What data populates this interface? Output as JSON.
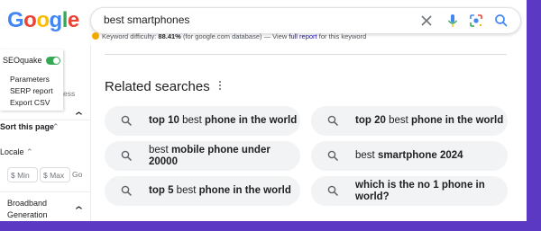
{
  "search": {
    "query": "best smartphones",
    "clear_icon": "close-icon",
    "voice_icon": "microphone-icon",
    "lens_icon": "lens-icon",
    "search_icon": "search-icon"
  },
  "logo": {
    "letters": [
      "G",
      "o",
      "o",
      "g",
      "l",
      "e"
    ],
    "colors": [
      "#4285f4",
      "#ea4335",
      "#fbbc05",
      "#4285f4",
      "#34a853",
      "#ea4335"
    ]
  },
  "keyword_difficulty": {
    "label": "Keyword difficulty:",
    "value": "88.41%",
    "note": "(for google.com database) — View",
    "link": "full report",
    "suffix": "for this keyword"
  },
  "seoquake": {
    "title": "SEOquake",
    "toggle_on": true,
    "items": [
      "Parameters",
      "SERP report",
      "Export CSV"
    ]
  },
  "left_panel": {
    "truncated_label": "ess",
    "sort_label": "Sort this page",
    "locale_label": "Locale",
    "price_min_placeholder": "$ Min",
    "price_max_placeholder": "$ Max",
    "go_label": "Go",
    "broadband_label": "Broadband Generation"
  },
  "related": {
    "title": "Related searches",
    "chips": [
      {
        "parts": [
          {
            "t": "top 10",
            "b": true
          },
          {
            "t": " best ",
            "b": false
          },
          {
            "t": "phone in the world",
            "b": true
          }
        ]
      },
      {
        "parts": [
          {
            "t": "top 20",
            "b": true
          },
          {
            "t": " best ",
            "b": false
          },
          {
            "t": "phone in the world",
            "b": true
          }
        ]
      },
      {
        "parts": [
          {
            "t": "best ",
            "b": false
          },
          {
            "t": "mobile phone under 20000",
            "b": true
          }
        ]
      },
      {
        "parts": [
          {
            "t": "best ",
            "b": false
          },
          {
            "t": "smartphone 2024",
            "b": true
          }
        ]
      },
      {
        "parts": [
          {
            "t": "top 5",
            "b": true
          },
          {
            "t": " best ",
            "b": false
          },
          {
            "t": "phone in the world",
            "b": true
          }
        ]
      },
      {
        "parts": [
          {
            "t": "which is the no 1 phone in world?",
            "b": true
          }
        ]
      }
    ]
  },
  "colors": {
    "frame_bg": "#5b39c2",
    "chip_bg": "#f1f3f4",
    "link": "#1a0dab",
    "toggle": "#34a853"
  }
}
